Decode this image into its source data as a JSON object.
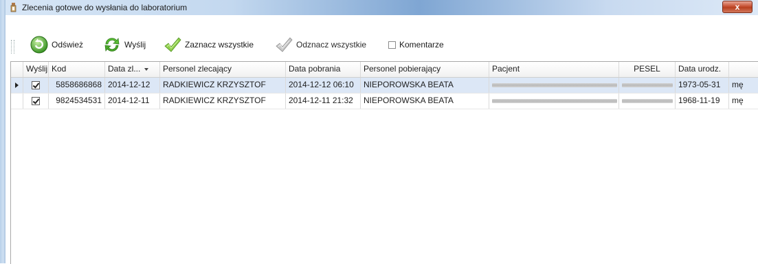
{
  "window": {
    "title": "Zlecenia gotowe do wysłania do laboratorium",
    "close_glyph": "x"
  },
  "toolbar": {
    "refresh": {
      "label": "Odśwież",
      "icon": "refresh-icon"
    },
    "send": {
      "label": "Wyślij",
      "icon": "send-icon"
    },
    "select_all": {
      "label": "Zaznacz wszystkie",
      "icon": "check-all-icon"
    },
    "deselect_all": {
      "label": "Odznacz wszystkie",
      "icon": "uncheck-all-icon"
    },
    "comments": {
      "label": "Komentarze",
      "checked": false
    }
  },
  "grid": {
    "columns": [
      "Wyślij",
      "Kod",
      "Data zl...",
      "Personel zlecający",
      "Data pobrania",
      "Personel pobierający",
      "Pacjent",
      "PESEL",
      "Data urodz.",
      ""
    ],
    "rows": [
      {
        "send": true,
        "kod": "5858686868",
        "data_zl": "2014-12-12",
        "personel_zl": "RADKIEWICZ KRZYSZTOF",
        "data_pob": "2014-12-12 06:10",
        "personel_pob": "NIEPOROWSKA BEATA",
        "data_ur": "1973-05-31",
        "plec": "mę"
      },
      {
        "send": true,
        "kod": "9824534531",
        "data_zl": "2014-12-11",
        "personel_zl": "RADKIEWICZ KRZYSZTOF",
        "data_pob": "2014-12-11 21:32",
        "personel_pob": "NIEPOROWSKA BEATA",
        "data_ur": "1968-11-19",
        "plec": "mę"
      }
    ]
  },
  "colors": {
    "selected_row": "#dce7f6",
    "close_button": "#c75235"
  }
}
